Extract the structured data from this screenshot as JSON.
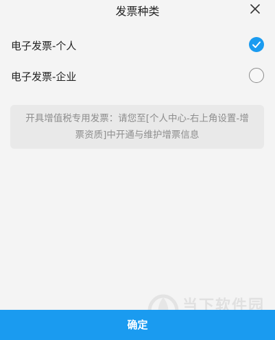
{
  "header": {
    "title": "发票种类"
  },
  "options": [
    {
      "label": "电子发票-个人",
      "selected": true
    },
    {
      "label": "电子发票-企业",
      "selected": false
    }
  ],
  "notice": {
    "text": "开具增值税专用发票：请您至[个人中心-右上角设置-增票资质]中开通与维护增票信息"
  },
  "watermark": {
    "name": "当下软件园",
    "url": "www.downxia.com"
  },
  "footer": {
    "confirm_label": "确定"
  },
  "colors": {
    "accent": "#1a9bf0",
    "background": "#f4f4f4",
    "notice_bg": "#e9e9e9"
  }
}
